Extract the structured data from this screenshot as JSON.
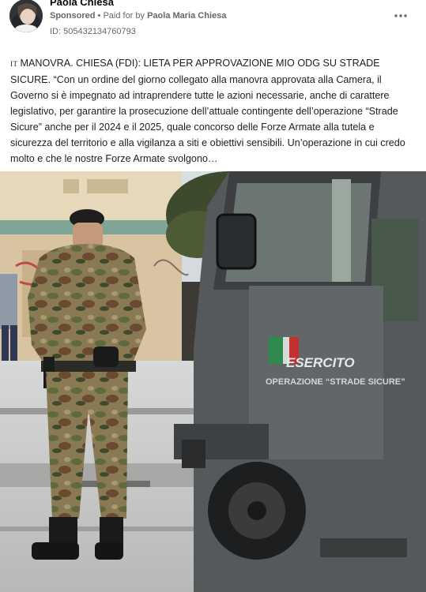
{
  "post": {
    "author": "Paola Chiesa",
    "sponsored_label": "Sponsored",
    "bullet": "•",
    "paid_by_prefix": "Paid for by",
    "paid_by_name": "Paola Maria Chiesa",
    "id_line": "ID: 505432134760793",
    "flag_text": "IT",
    "body_text": "MANOVRA. CHIESA (FDI): LIETA PER APPROVAZIONE MIO ODG SU STRADE SICURE. “Con un ordine del giorno collegato alla manovra approvata alla Camera, il Governo si è impegnato ad intraprendere tutte le azioni necessarie, anche di carattere legislativo, per garantire la prosecuzione dell’attuale contingente dell’operazione “Strade Sicure” anche per il 2024 e il 2025, quale concorso delle Forze Armate alla tutela e sicurezza del territorio e alla vigilanza a siti e obiettivi sensibili. Un’operazione in cui credo molto e che le nostre Forze Armate svolgono…"
  },
  "photo": {
    "vehicle_logo_text": "ESERCITO",
    "vehicle_operation_text": "OPERAZIONE “STRADE SICURE”"
  },
  "icons": {
    "more": "more-horizontal-icon"
  }
}
